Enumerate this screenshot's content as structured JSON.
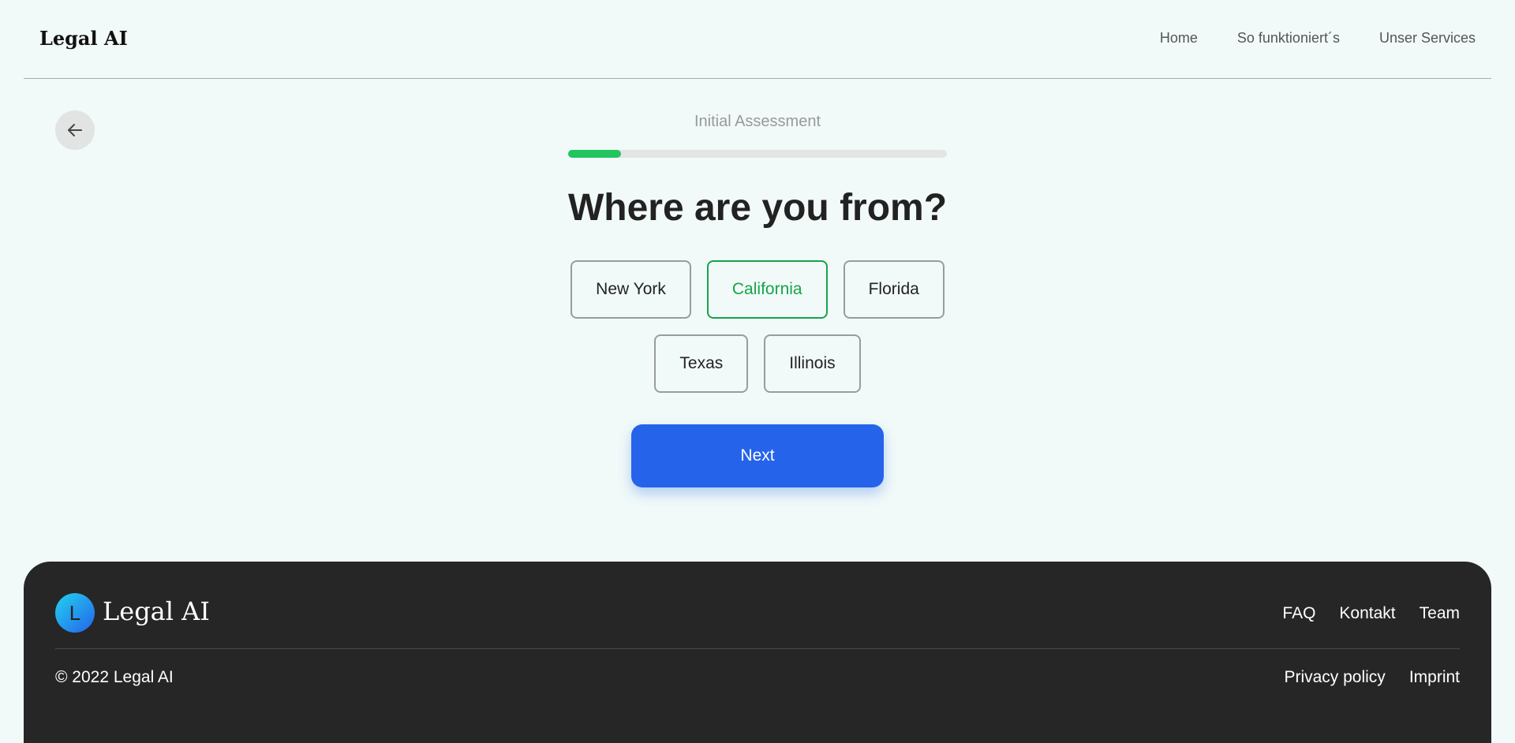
{
  "header": {
    "logo": "Legal AI",
    "nav": [
      {
        "label": "Home"
      },
      {
        "label": "So funktioniert´s"
      },
      {
        "label": "Unser Services"
      }
    ]
  },
  "assessment": {
    "back_icon": "arrow-left-icon",
    "step_title": "Initial Assessment",
    "progress": 0.14,
    "progress_color": "#22c55e",
    "question": "Where are you from?",
    "options": [
      {
        "label": "New York",
        "selected": false
      },
      {
        "label": "California",
        "selected": true
      },
      {
        "label": "Florida",
        "selected": false
      },
      {
        "label": "Texas",
        "selected": false
      },
      {
        "label": "Illinois",
        "selected": false
      }
    ],
    "next_label": "Next",
    "accent_color": "#2563eb",
    "selected_color": "#16a34a"
  },
  "footer": {
    "logo_letter": "L",
    "logo_text": "Legal AI",
    "links": [
      {
        "label": "FAQ"
      },
      {
        "label": "Kontakt"
      },
      {
        "label": "Team"
      }
    ],
    "copyright": "© 2022 Legal AI",
    "legal": [
      {
        "label": "Privacy policy"
      },
      {
        "label": "Imprint"
      }
    ]
  }
}
